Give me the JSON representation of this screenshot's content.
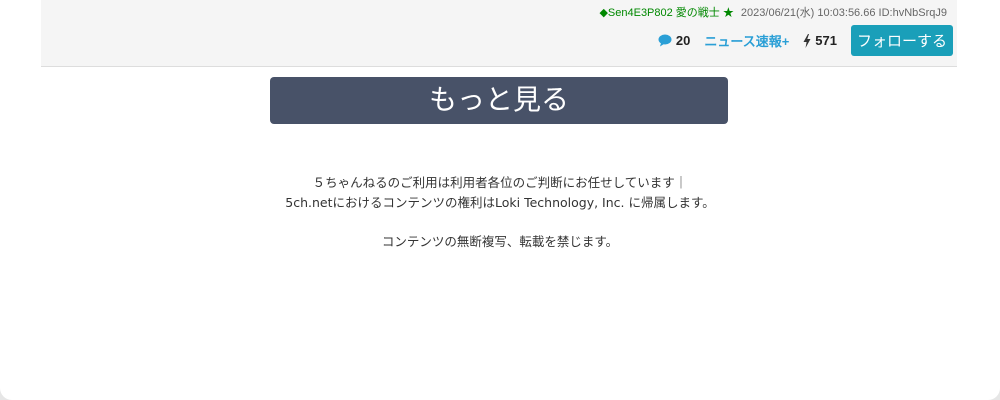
{
  "post": {
    "author": "◆Sen4E3P802 愛の戦士 ★",
    "datetime": "2023/06/21(水) 10:03:56.66 ID:hvNbSrqJ9"
  },
  "stats": {
    "comments_icon": "comment-icon",
    "comments_count": "20",
    "news_link": "ニュース速報+",
    "bolt_icon": "bolt-icon",
    "momentum": "571",
    "follow_label": "フォローする"
  },
  "more": {
    "label": "もっと見る"
  },
  "footer": {
    "line1": "５ちゃんねるのご利用は利用者各位のご判断にお任せしています｜",
    "line2": "5ch.netにおけるコンテンツの権利はLoki Technology, Inc. に帰属します。",
    "line3": "コンテンツの無断複写、転載を禁じます。"
  },
  "colors": {
    "follow_button": "#1a9fb9",
    "more_button": "#485268",
    "link": "#2a9fd6",
    "author": "#008800"
  }
}
